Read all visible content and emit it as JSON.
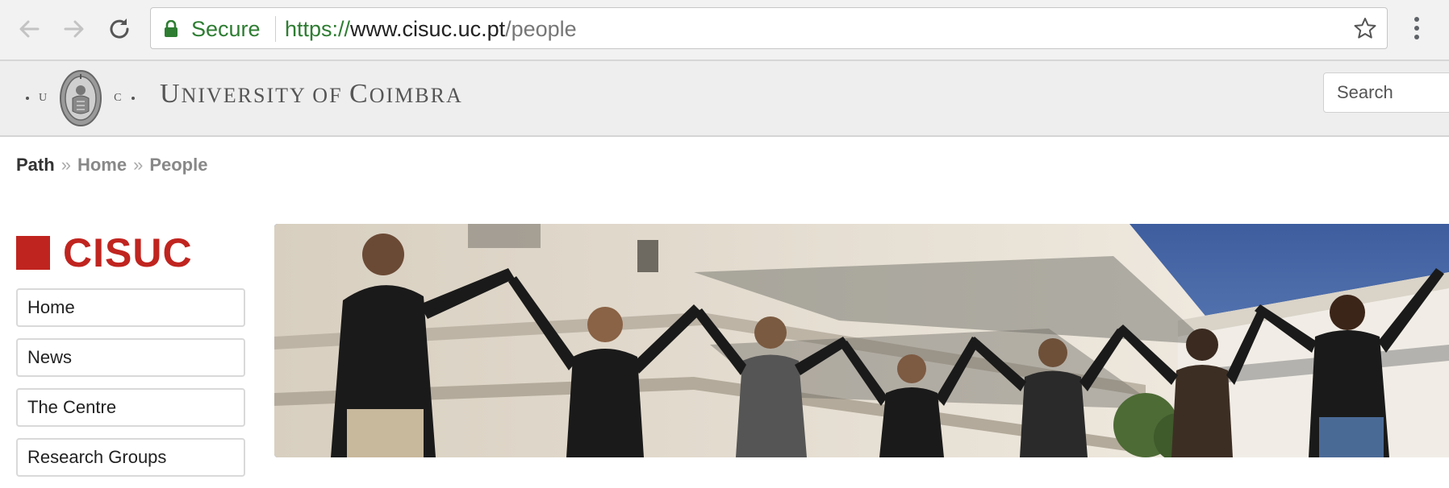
{
  "browser": {
    "secure_label": "Secure",
    "url_scheme": "https://",
    "url_host": "www.cisuc.uc.pt",
    "url_path": "/people",
    "secure_color": "#2e7d32"
  },
  "header": {
    "seal_letters": [
      "U",
      "C"
    ],
    "university_name": [
      "U",
      "NIVERSITY OF ",
      "C",
      "OIMBRA"
    ],
    "search_placeholder": "Search"
  },
  "breadcrumb": {
    "label": "Path",
    "items": [
      "Home",
      "People"
    ]
  },
  "sidebar": {
    "brand": "CISUC",
    "brand_color": "#c0241f",
    "items": [
      {
        "label": "Home"
      },
      {
        "label": "News"
      },
      {
        "label": "The Centre"
      },
      {
        "label": "Research Groups"
      }
    ]
  }
}
